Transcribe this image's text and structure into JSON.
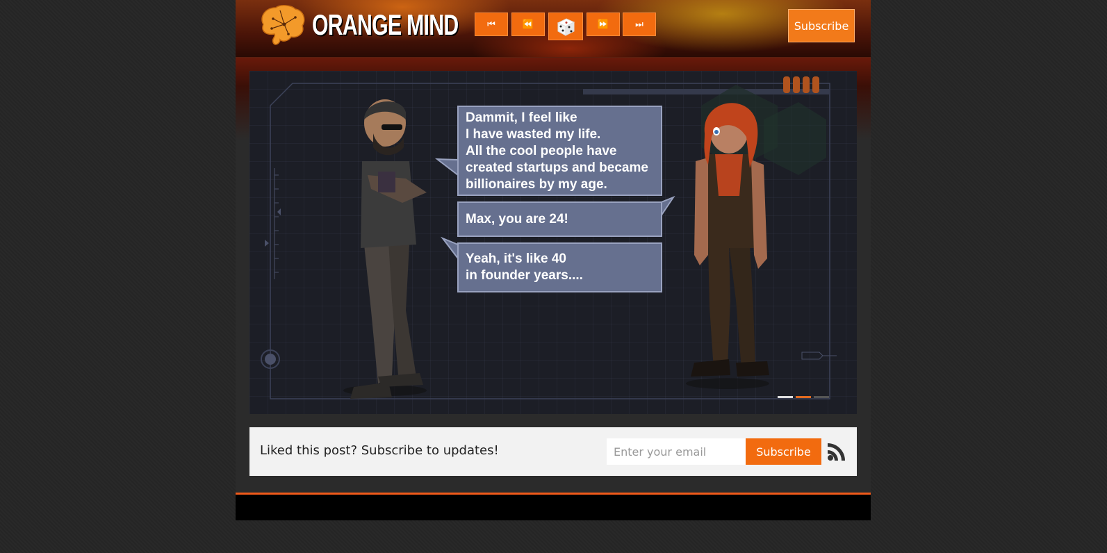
{
  "header": {
    "logo_text": "ORANGE MIND",
    "nav": {
      "first_label": "⏮",
      "prev_label": "⏪",
      "random_label": "⚄",
      "next_label": "⏩",
      "last_label": "⏭"
    },
    "subscribe_label": "Subscribe"
  },
  "comic": {
    "bubbles": [
      "Dammit, I feel like\nI have wasted my life.\nAll the cool people have\ncreated startups and became\nbillionaires by my age.",
      "Max, you are 24!",
      "Yeah, it's like 40\nin founder years...."
    ]
  },
  "subscribe_box": {
    "text": "Liked this post? Subscribe to updates!",
    "email_placeholder": "Enter your email",
    "button_label": "Subscribe"
  },
  "colors": {
    "accent": "#f26b0f",
    "bubble": "#66708f",
    "footer_line": "#f05a1a"
  },
  "icons": [
    "brain-logo-icon",
    "first-icon",
    "previous-icon",
    "random-dice-icon",
    "next-icon",
    "last-icon",
    "rss-icon"
  ]
}
